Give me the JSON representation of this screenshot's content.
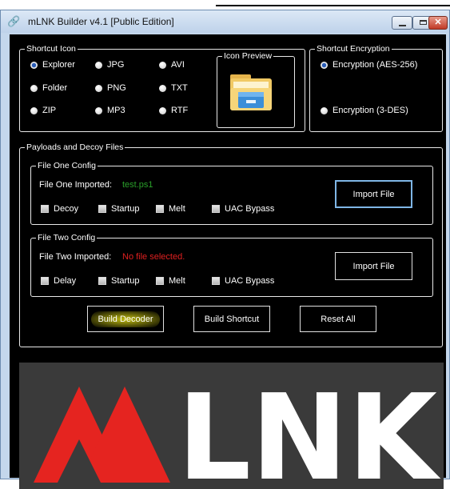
{
  "window": {
    "title": "mLNK Builder v4.1 [Public Edition]",
    "icon": "link-icon",
    "controls": {
      "minimize": "minimize-icon",
      "maximize": "maximize-icon",
      "close": "✕"
    }
  },
  "shortcut_icon": {
    "legend": "Shortcut Icon",
    "options": [
      {
        "label": "Explorer",
        "checked": true
      },
      {
        "label": "JPG",
        "checked": false
      },
      {
        "label": "AVI",
        "checked": false
      },
      {
        "label": "Folder",
        "checked": false
      },
      {
        "label": "PNG",
        "checked": false
      },
      {
        "label": "TXT",
        "checked": false
      },
      {
        "label": "ZIP",
        "checked": false
      },
      {
        "label": "MP3",
        "checked": false
      },
      {
        "label": "RTF",
        "checked": false
      }
    ],
    "preview_legend": "Icon Preview",
    "preview_icon": "explorer-folder-icon"
  },
  "encryption": {
    "legend": "Shortcut Encryption",
    "options": [
      {
        "label": "Encryption (AES-256)",
        "checked": true
      },
      {
        "label": "Encryption (3-DES)",
        "checked": false
      }
    ]
  },
  "payloads": {
    "legend": "Payloads and Decoy Files",
    "file_one": {
      "legend": "File One Config",
      "imported_label": "File One Imported:",
      "imported_value": "test.ps1",
      "checkboxes": [
        "Decoy",
        "Startup",
        "Melt",
        "UAC Bypass"
      ],
      "import_button": "Import File"
    },
    "file_two": {
      "legend": "File Two Config",
      "imported_label": "File Two Imported:",
      "imported_value": "No file selected.",
      "checkboxes": [
        "Delay",
        "Startup",
        "Melt",
        "UAC Bypass"
      ],
      "import_button": "Import File"
    }
  },
  "actions": {
    "build_decoder": "Build Decoder",
    "build_shortcut": "Build Shortcut",
    "reset_all": "Reset All"
  },
  "banner": {
    "text": "LNK",
    "logo": "lnk-logo"
  },
  "colors": {
    "accent_red": "#e52420",
    "ok_green": "#2aa02a",
    "error_red": "#e02020",
    "focus_blue": "#7fb6e6"
  }
}
